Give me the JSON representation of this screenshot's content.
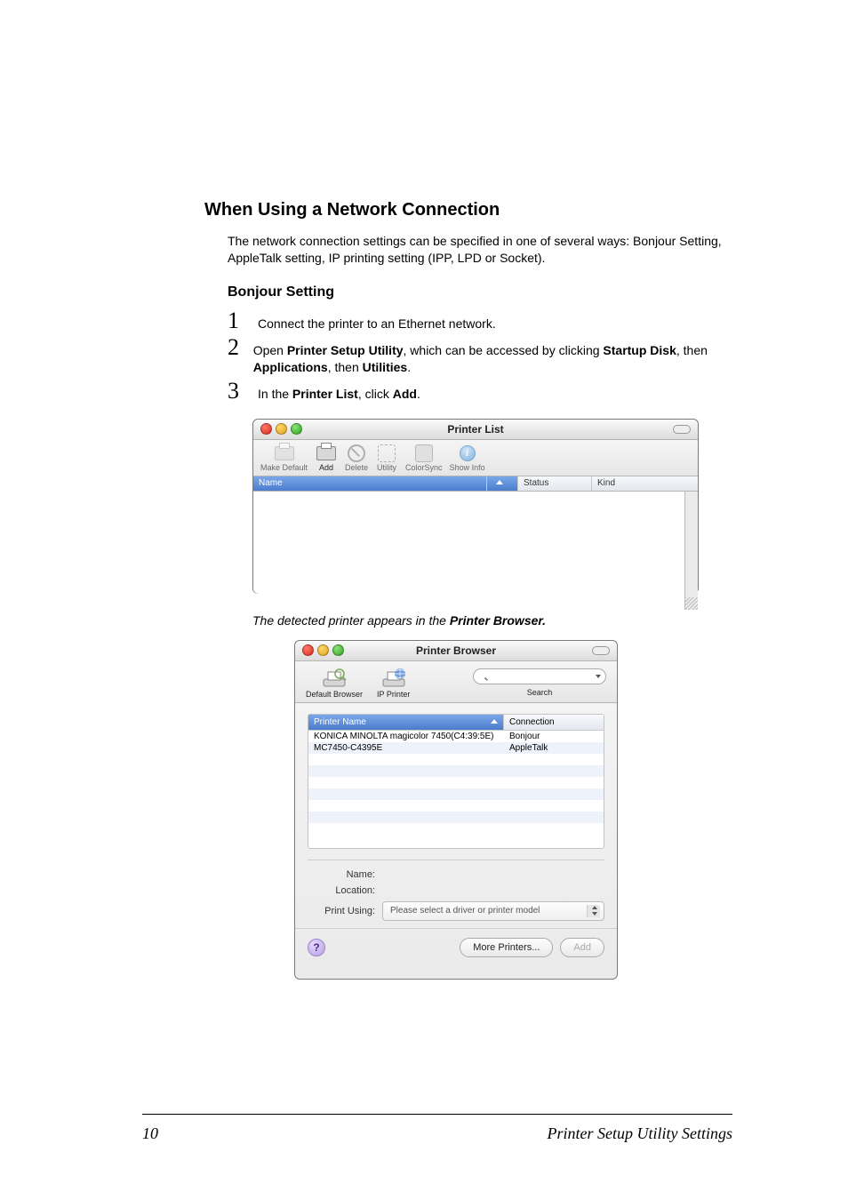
{
  "headings": {
    "h1": "When Using a Network Connection",
    "h2": "Bonjour Setting"
  },
  "intro": "The network connection settings can be specified in one of several ways: Bonjour Setting, AppleTalk setting, IP printing setting (IPP, LPD or Socket).",
  "steps": {
    "s1": {
      "num": "1",
      "text_a": "Connect the printer to an Ethernet network."
    },
    "s2": {
      "num": "2",
      "text_a": "Open ",
      "b1": "Printer Setup Utility",
      "text_b": ", which can be accessed by clicking ",
      "b2": "Startup Disk",
      "text_c": ", then ",
      "b3": "Applications",
      "text_d": ", then ",
      "b4": "Utilities",
      "text_e": "."
    },
    "s3": {
      "num": "3",
      "text_a": "In the ",
      "b1": "Printer List",
      "text_b": ", click ",
      "b2": "Add",
      "text_c": "."
    }
  },
  "note": {
    "pre": "The detected printer appears in the ",
    "bold": "Printer Browser."
  },
  "win1": {
    "title": "Printer List",
    "toolbar": {
      "make_default": "Make Default",
      "add": "Add",
      "delete": "Delete",
      "utility": "Utility",
      "colorsync": "ColorSync",
      "showinfo": "Show Info"
    },
    "cols": {
      "name": "Name",
      "status": "Status",
      "kind": "Kind"
    }
  },
  "win2": {
    "title": "Printer Browser",
    "toolbar": {
      "default_browser": "Default Browser",
      "ip_printer": "IP Printer",
      "search": "Search"
    },
    "search_placeholder": "",
    "cols": {
      "printer_name": "Printer Name",
      "connection": "Connection"
    },
    "rows": [
      {
        "name": "KONICA MINOLTA magicolor 7450(C4:39:5E)",
        "conn": "Bonjour"
      },
      {
        "name": "MC7450-C4395E",
        "conn": "AppleTalk"
      }
    ],
    "form": {
      "name": "Name:",
      "location": "Location:",
      "print_using": "Print Using:",
      "print_using_value": "Please select a driver or printer model"
    },
    "buttons": {
      "help": "?",
      "more": "More Printers...",
      "add": "Add"
    }
  },
  "footer": {
    "page": "10",
    "title": "Printer Setup Utility Settings"
  }
}
